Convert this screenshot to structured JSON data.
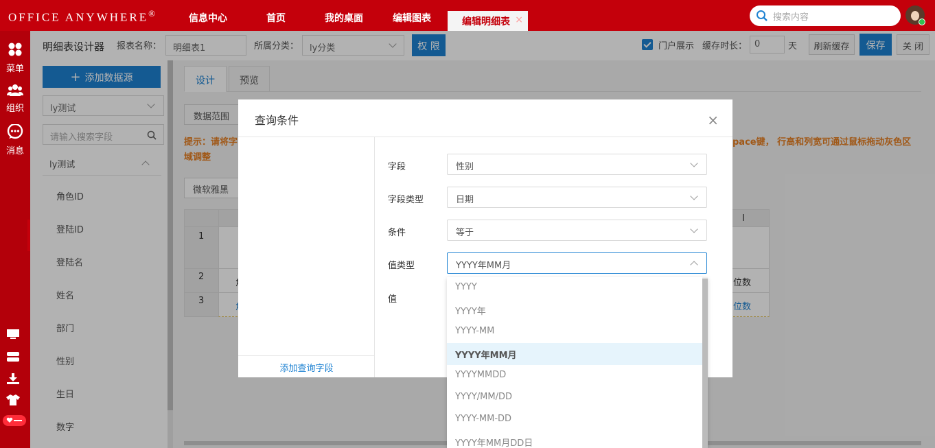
{
  "app": {
    "logo_text": "OFFICE ANYWHERE",
    "logo_mark": "®"
  },
  "topnav": {
    "items": [
      "信息中心",
      "首页",
      "我的桌面",
      "编辑图表"
    ],
    "active_tab": "编辑明细表",
    "active_tab_close": "×",
    "search_placeholder": "搜索内容"
  },
  "rail": {
    "menu": "菜单",
    "group": "组织",
    "message": "消息"
  },
  "header": {
    "title": "明细表设计器",
    "report_name_label": "报表名称：",
    "report_name_value": "明细表1",
    "category_label": "所属分类：",
    "category_value": "ly分类",
    "permission_button": "权 限",
    "portal_label": "门户展示",
    "cache_label": "缓存时长：",
    "cache_value": "0",
    "cache_unit": "天",
    "refresh_button": "刷新缓存",
    "save_button": "保存",
    "close_button": "关 闭"
  },
  "left_panel": {
    "add_source_button": "添加数据源",
    "source_select": "ly测试",
    "search_placeholder": "请输入搜索字段",
    "group_name": "ly测试",
    "fields": [
      "角色ID",
      "登陆ID",
      "登陆名",
      "姓名",
      "部门",
      "性别",
      "生日",
      "数字"
    ]
  },
  "main": {
    "tabs": [
      "设计",
      "预览"
    ],
    "data_range_button": "数据范围",
    "hint_prefix": "提示：请将字",
    "hint_suffix": "pace键， 行高和列宽可通过鼠标拖动灰色区",
    "hint_line2": "域调整",
    "font_select": "微软雅黑",
    "col_i": "I",
    "rows": [
      "1",
      "2",
      "3"
    ],
    "cell_r2_left": "角",
    "cell_r2_right": "位数",
    "cell_r3_left": "角",
    "cell_r3_right": "位数"
  },
  "dialog": {
    "title": "查询条件",
    "close": "×",
    "add_field_link": "添加查询字段",
    "form": {
      "field_label": "字段",
      "field_value": "性别",
      "type_label": "字段类型",
      "type_value": "日期",
      "condition_label": "条件",
      "condition_value": "等于",
      "value_type_label": "值类型",
      "value_type_value": "YYYY年MM月",
      "value_label": "值"
    },
    "value_type_options": [
      "YYYY",
      "YYYY年",
      "YYYY-MM",
      "YYYY年MM月",
      "YYYYMMDD",
      "YYYY/MM/DD",
      "YYYY-MM-DD",
      "YYYY年MM月DD日"
    ],
    "selected_index": 3
  },
  "colors": {
    "brand_red": "#c4000b",
    "accent_blue": "#1e82d2",
    "hint_orange": "#e67e22"
  }
}
